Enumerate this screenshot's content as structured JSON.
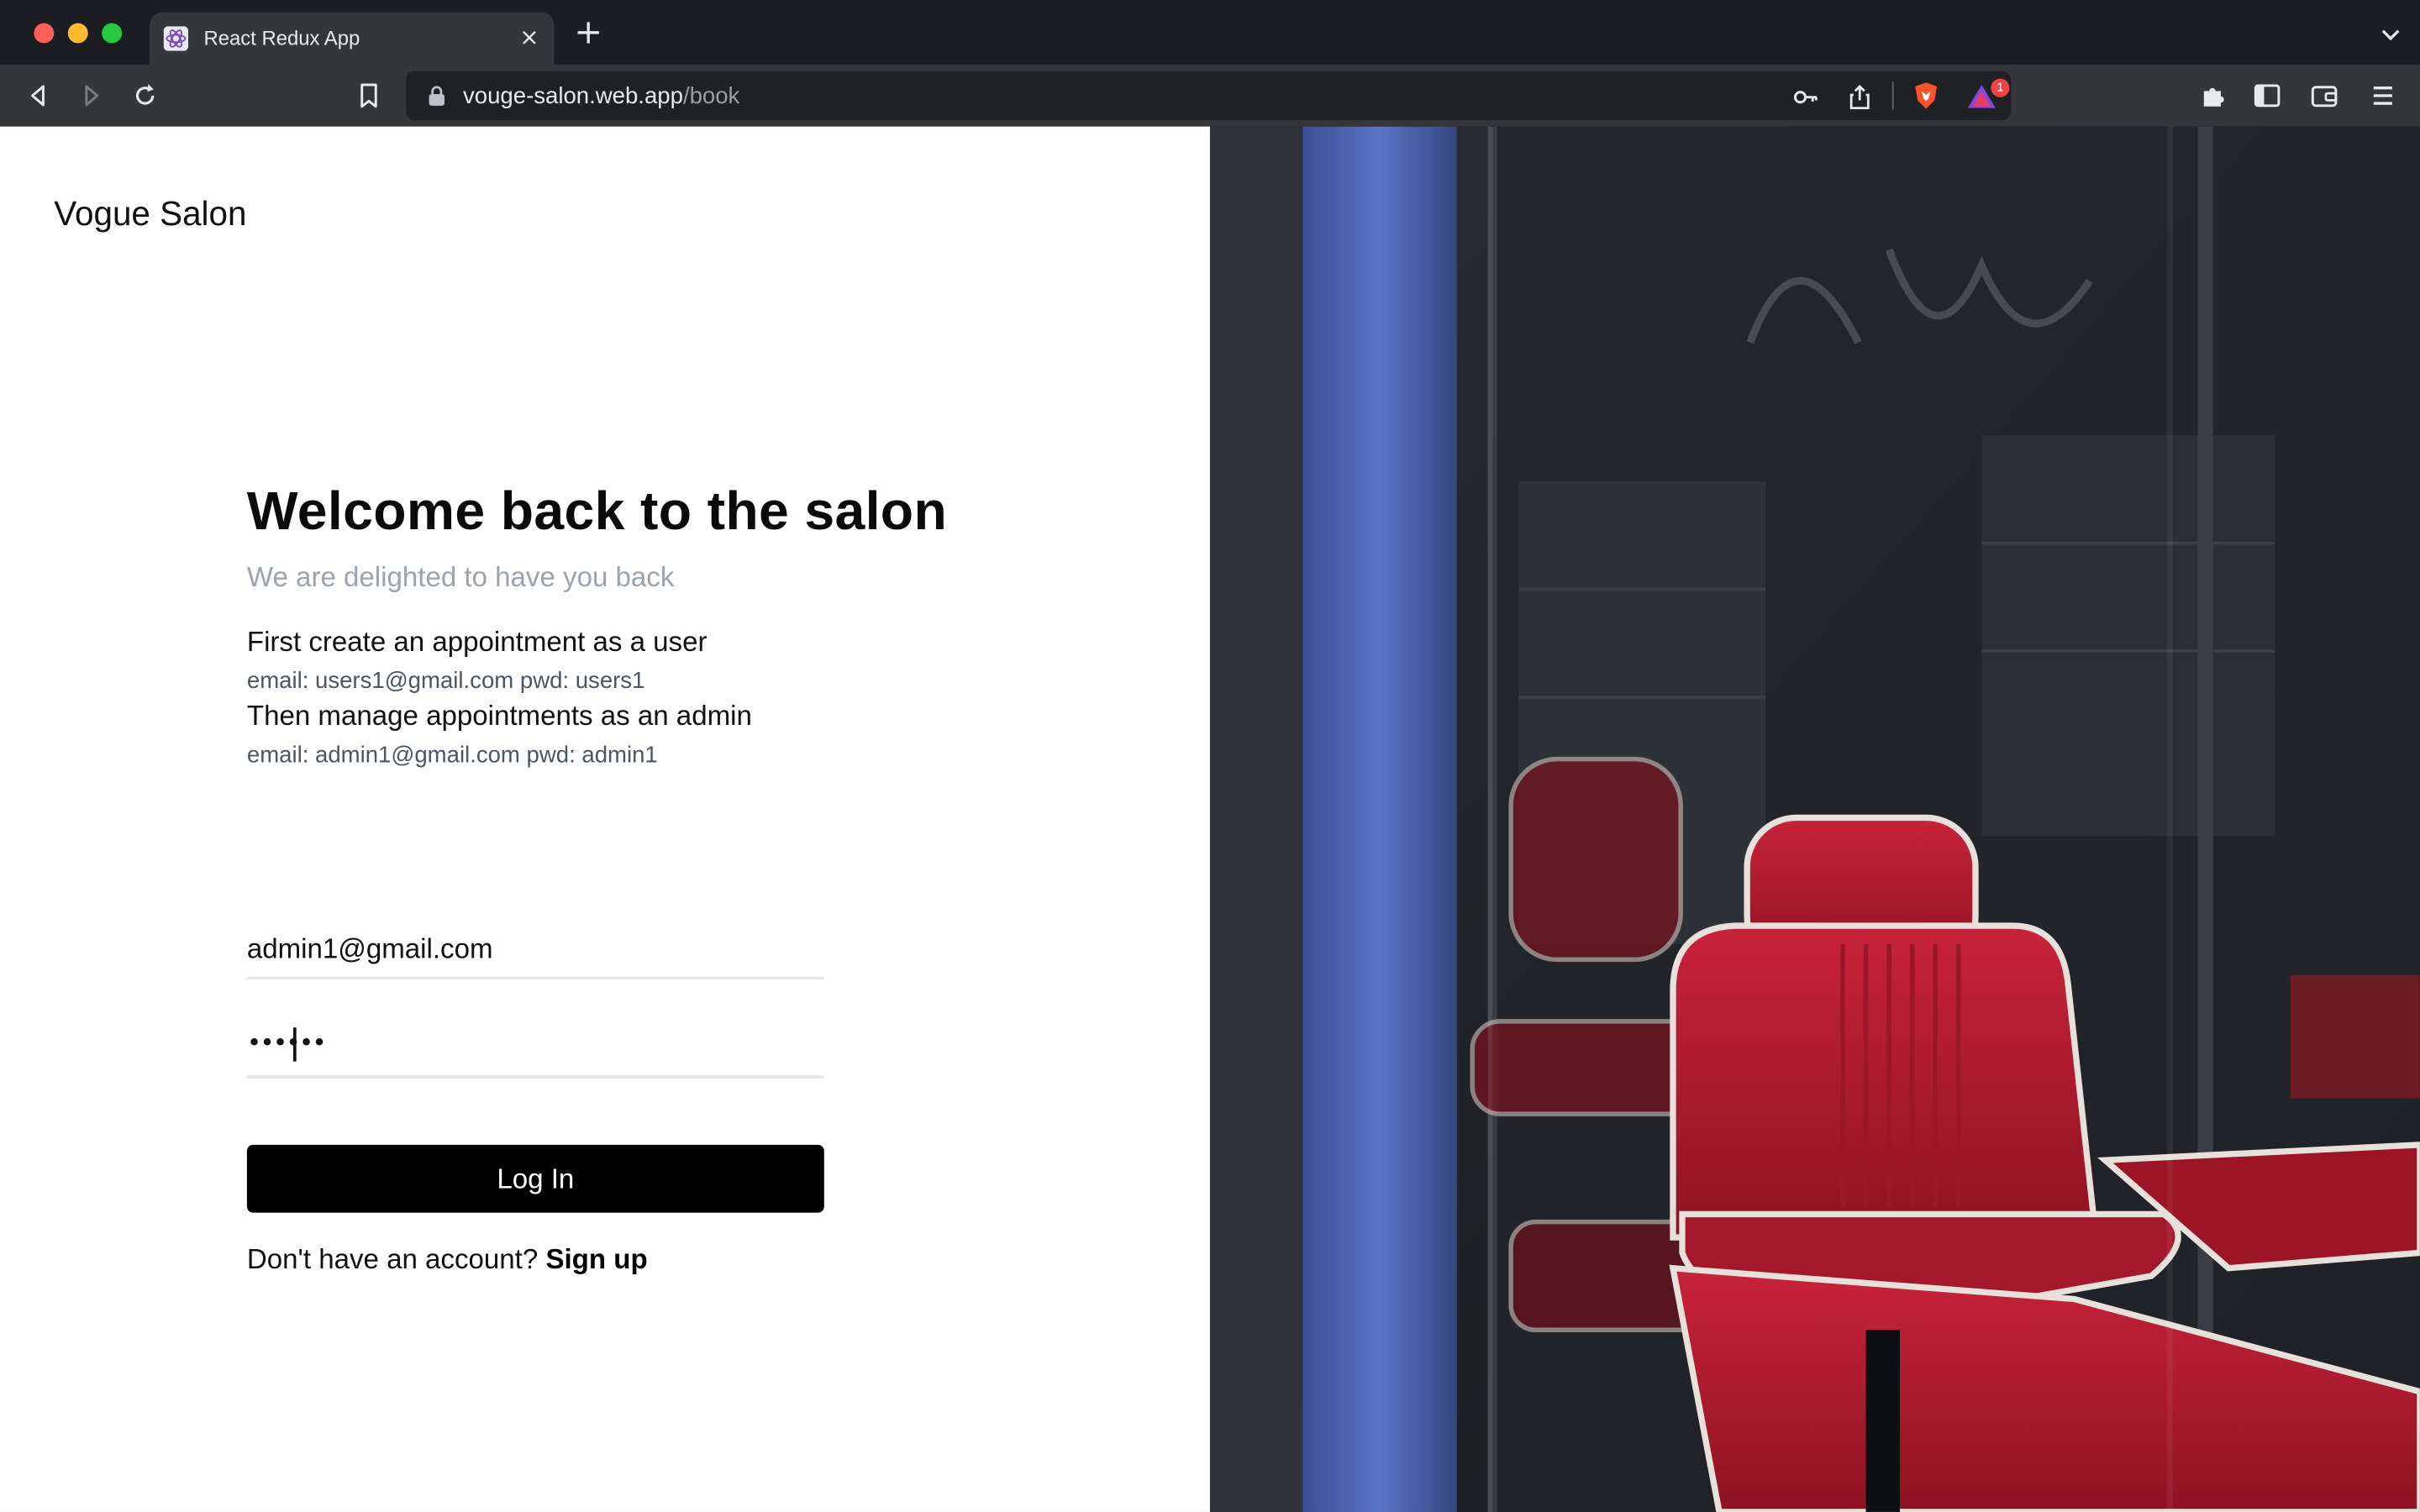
{
  "browser": {
    "tab_title": "React Redux App",
    "new_tab_label": "+",
    "close_tab_label": "×",
    "url_host": "vouge-salon.web.app",
    "url_path": "/book",
    "notification_count": "1"
  },
  "page": {
    "brand": "Vogue Salon",
    "heading": "Welcome back to the salon",
    "subheading": "We are delighted to have you back",
    "steps": [
      {
        "title": "First create an appointment as a user",
        "credentials": "email: users1@gmail.com pwd: users1"
      },
      {
        "title": "Then manage appointments as an admin",
        "credentials": "email: admin1@gmail.com pwd: admin1"
      }
    ],
    "email_value": "admin1@gmail.com",
    "password_masked": "••••••",
    "login_label": "Log In",
    "signup_prompt": "Don't have an account?",
    "signup_label": "Sign up"
  },
  "icons": [
    "back-icon",
    "forward-icon",
    "reload-icon",
    "bookmark-icon",
    "lock-icon",
    "key-icon",
    "share-icon",
    "brave-shield-icon",
    "brave-rewards-icon",
    "extensions-icon",
    "sidebar-icon",
    "wallet-icon",
    "menu-icon"
  ],
  "colors": {
    "chair_red": "#b3172a",
    "accent_blue": "#4a63b5",
    "button_black": "#000000",
    "subheading_gray": "#9ca3af"
  }
}
